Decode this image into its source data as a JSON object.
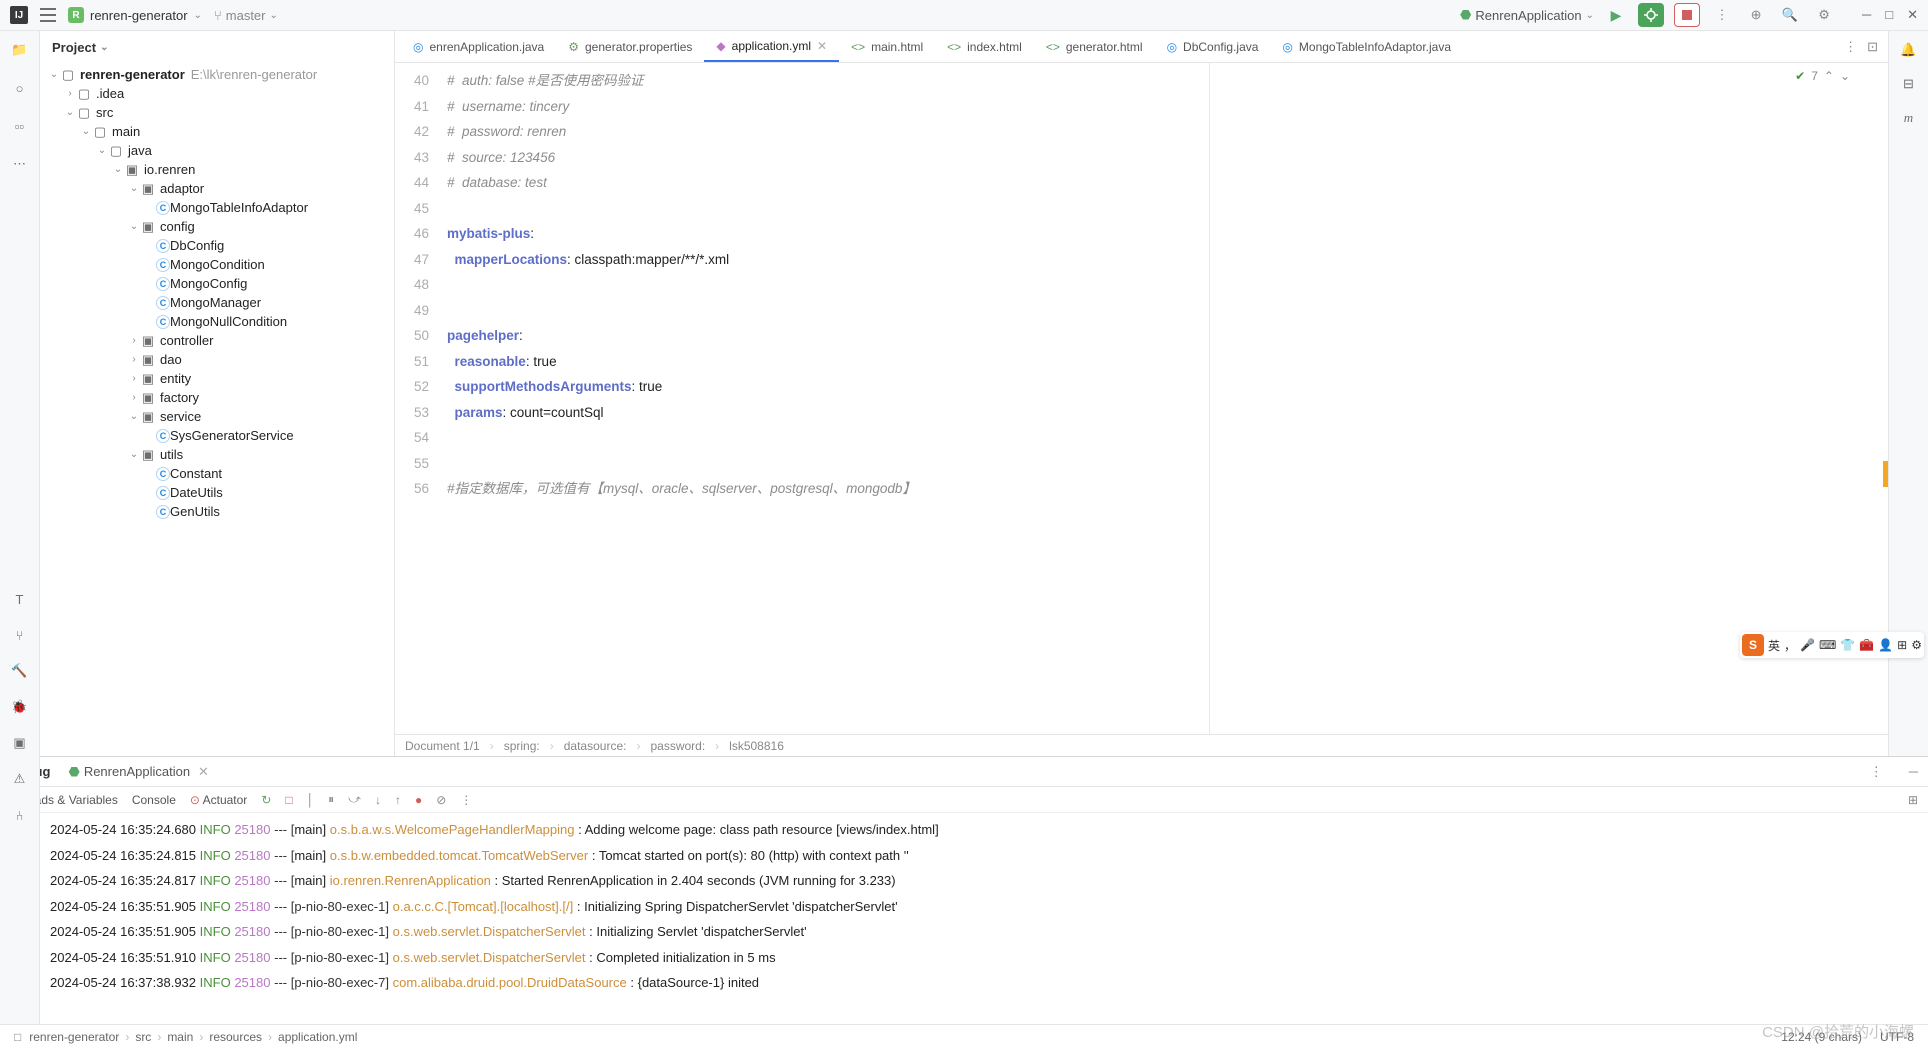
{
  "titlebar": {
    "project_name": "renren-generator",
    "branch": "master",
    "run_config": "RenrenApplication"
  },
  "project_panel": {
    "title": "Project",
    "root": {
      "name": "renren-generator",
      "path": "E:\\lk\\renren-generator"
    },
    "tree": {
      "idea": ".idea",
      "src": "src",
      "main": "main",
      "java": "java",
      "pkg": "io.renren",
      "adaptor": "adaptor",
      "adaptor_file": "MongoTableInfoAdaptor",
      "config": "config",
      "config_files": [
        "DbConfig",
        "MongoCondition",
        "MongoConfig",
        "MongoManager",
        "MongoNullCondition"
      ],
      "controller": "controller",
      "dao": "dao",
      "entity": "entity",
      "factory": "factory",
      "service": "service",
      "service_file": "SysGeneratorService",
      "utils": "utils",
      "utils_files": [
        "Constant",
        "DateUtils",
        "GenUtils"
      ]
    }
  },
  "tabs": [
    {
      "label": "enrenApplication.java",
      "icon": "◎",
      "color": "#1e88e5"
    },
    {
      "label": "generator.properties",
      "icon": "⚙",
      "color": "#6e9e5f"
    },
    {
      "label": "application.yml",
      "icon": "◆",
      "color": "#b977c4",
      "active": true
    },
    {
      "label": "main.html",
      "icon": "<>",
      "color": "#5e9e5f"
    },
    {
      "label": "index.html",
      "icon": "<>",
      "color": "#5e9e5f"
    },
    {
      "label": "generator.html",
      "icon": "<>",
      "color": "#5e9e5f"
    },
    {
      "label": "DbConfig.java",
      "icon": "◎",
      "color": "#1e88e5"
    },
    {
      "label": "MongoTableInfoAdaptor.java",
      "icon": "◎",
      "color": "#1e88e5"
    }
  ],
  "editor": {
    "badge": "7",
    "lines": [
      {
        "n": 40,
        "type": "comment",
        "text": "#  auth: false #是否使用密码验证"
      },
      {
        "n": 41,
        "type": "comment",
        "text": "#  username: tincery"
      },
      {
        "n": 42,
        "type": "comment",
        "text": "#  password: renren"
      },
      {
        "n": 43,
        "type": "comment",
        "text": "#  source: 123456"
      },
      {
        "n": 44,
        "type": "comment",
        "text": "#  database: test"
      },
      {
        "n": 45,
        "type": "blank",
        "text": ""
      },
      {
        "n": 46,
        "type": "kv",
        "key": "mybatis-plus",
        "val": ":"
      },
      {
        "n": 47,
        "type": "kv",
        "indent": "  ",
        "key": "mapperLocations",
        "val": ": classpath:mapper/**/*.xml"
      },
      {
        "n": 48,
        "type": "blank",
        "text": ""
      },
      {
        "n": 49,
        "type": "blank",
        "text": ""
      },
      {
        "n": 50,
        "type": "kv",
        "key": "pagehelper",
        "val": ":"
      },
      {
        "n": 51,
        "type": "kv",
        "indent": "  ",
        "key": "reasonable",
        "val": ": true"
      },
      {
        "n": 52,
        "type": "kv",
        "indent": "  ",
        "key": "supportMethodsArguments",
        "val": ": true"
      },
      {
        "n": 53,
        "type": "kv",
        "indent": "  ",
        "key": "params",
        "val": ": count=countSql"
      },
      {
        "n": 54,
        "type": "blank",
        "text": ""
      },
      {
        "n": 55,
        "type": "blank",
        "text": ""
      },
      {
        "n": 56,
        "type": "comment",
        "text": "#指定数据库，可选值有【mysql、oracle、sqlserver、postgresql、mongodb】"
      }
    ],
    "crumbs": [
      "Document 1/1",
      "spring:",
      "datasource:",
      "password:",
      "lsk508816"
    ]
  },
  "debug": {
    "tab_debug": "Debug",
    "run_label": "RenrenApplication",
    "toolbar_tabs": [
      "Threads & Variables",
      "Console",
      "Actuator"
    ],
    "console": [
      {
        "ts": "2024-05-24 16:35:24.680",
        "lvl": "INFO",
        "pid": "25180",
        "sep": "--- [",
        "thread": "main]",
        "src": "o.s.b.a.w.s.WelcomePageHandlerMapping",
        "msg": ": Adding welcome page: class path resource [views/index.html]"
      },
      {
        "ts": "2024-05-24 16:35:24.815",
        "lvl": "INFO",
        "pid": "25180",
        "sep": "--- [",
        "thread": "main]",
        "src": "o.s.b.w.embedded.tomcat.TomcatWebServer",
        "msg": ": Tomcat started on port(s): 80 (http) with context path ''"
      },
      {
        "ts": "2024-05-24 16:35:24.817",
        "lvl": "INFO",
        "pid": "25180",
        "sep": "--- [",
        "thread": "main]",
        "src": "io.renren.RenrenApplication",
        "msg": ": Started RenrenApplication in 2.404 seconds (JVM running for 3.233)"
      },
      {
        "ts": "2024-05-24 16:35:51.905",
        "lvl": "INFO",
        "pid": "25180",
        "sep": "--- [p-nio-80-exec-1]",
        "thread": "",
        "src": "o.a.c.c.C.[Tomcat].[localhost].[/]",
        "msg": ": Initializing Spring DispatcherServlet 'dispatcherServlet'"
      },
      {
        "ts": "2024-05-24 16:35:51.905",
        "lvl": "INFO",
        "pid": "25180",
        "sep": "--- [p-nio-80-exec-1]",
        "thread": "",
        "src": "o.s.web.servlet.DispatcherServlet",
        "msg": ": Initializing Servlet 'dispatcherServlet'"
      },
      {
        "ts": "2024-05-24 16:35:51.910",
        "lvl": "INFO",
        "pid": "25180",
        "sep": "--- [p-nio-80-exec-1]",
        "thread": "",
        "src": "o.s.web.servlet.DispatcherServlet",
        "msg": ": Completed initialization in 5 ms"
      },
      {
        "ts": "2024-05-24 16:37:38.932",
        "lvl": "INFO",
        "pid": "25180",
        "sep": "--- [p-nio-80-exec-7]",
        "thread": "",
        "src": "com.alibaba.druid.pool.DruidDataSource",
        "msg": ": {dataSource-1} inited"
      }
    ]
  },
  "statusbar": {
    "breadcrumbs": [
      "renren-generator",
      "src",
      "main",
      "resources",
      "application.yml"
    ],
    "position": "12:24 (9 chars)",
    "encoding": "UTF-8"
  },
  "watermark": "CSDN @拾荒的小海螺",
  "ime": {
    "s": "S",
    "lang": "英"
  }
}
